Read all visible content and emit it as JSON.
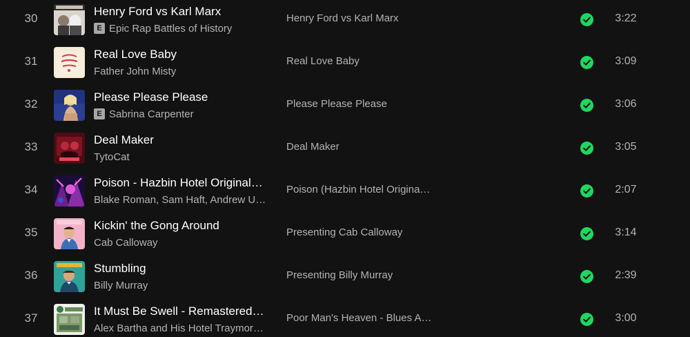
{
  "tracks": [
    {
      "number": "30",
      "title": "Henry Ford vs Karl Marx",
      "explicit": true,
      "explicit_label": "E",
      "artist": "Epic Rap Battles of History",
      "album": "Henry Ford vs Karl Marx",
      "saved": true,
      "duration": "3:22"
    },
    {
      "number": "31",
      "title": "Real Love Baby",
      "explicit": false,
      "explicit_label": "",
      "artist": "Father John Misty",
      "album": "Real Love Baby",
      "saved": true,
      "duration": "3:09"
    },
    {
      "number": "32",
      "title": "Please Please Please",
      "explicit": true,
      "explicit_label": "E",
      "artist": "Sabrina Carpenter",
      "album": "Please Please Please",
      "saved": true,
      "duration": "3:06"
    },
    {
      "number": "33",
      "title": "Deal Maker",
      "explicit": false,
      "explicit_label": "",
      "artist": "TytoCat",
      "album": "Deal Maker",
      "saved": true,
      "duration": "3:05"
    },
    {
      "number": "34",
      "title": "Poison - Hazbin Hotel Original…",
      "explicit": false,
      "explicit_label": "",
      "artist": "Blake Roman, Sam Haft, Andrew U…",
      "album": "Poison (Hazbin Hotel Origina…",
      "saved": true,
      "duration": "2:07"
    },
    {
      "number": "35",
      "title": "Kickin' the Gong Around",
      "explicit": false,
      "explicit_label": "",
      "artist": "Cab Calloway",
      "album": "Presenting Cab Calloway",
      "saved": true,
      "duration": "3:14"
    },
    {
      "number": "36",
      "title": "Stumbling",
      "explicit": false,
      "explicit_label": "",
      "artist": "Billy Murray",
      "album": "Presenting Billy Murray",
      "saved": true,
      "duration": "2:39"
    },
    {
      "number": "37",
      "title": "It Must Be Swell - Remastered…",
      "explicit": false,
      "explicit_label": "",
      "artist": "Alex Bartha and His Hotel Traymor…",
      "album": "Poor Man's Heaven - Blues A…",
      "saved": true,
      "duration": "3:00"
    }
  ],
  "colors": {
    "background": "#121212",
    "title_text": "#ffffff",
    "secondary_text": "#b3b3b3",
    "saved_check": "#1ed760",
    "explicit_badge": "#a7a7a7"
  },
  "icons": {
    "saved": "check-circle-icon",
    "explicit": "explicit-badge"
  }
}
